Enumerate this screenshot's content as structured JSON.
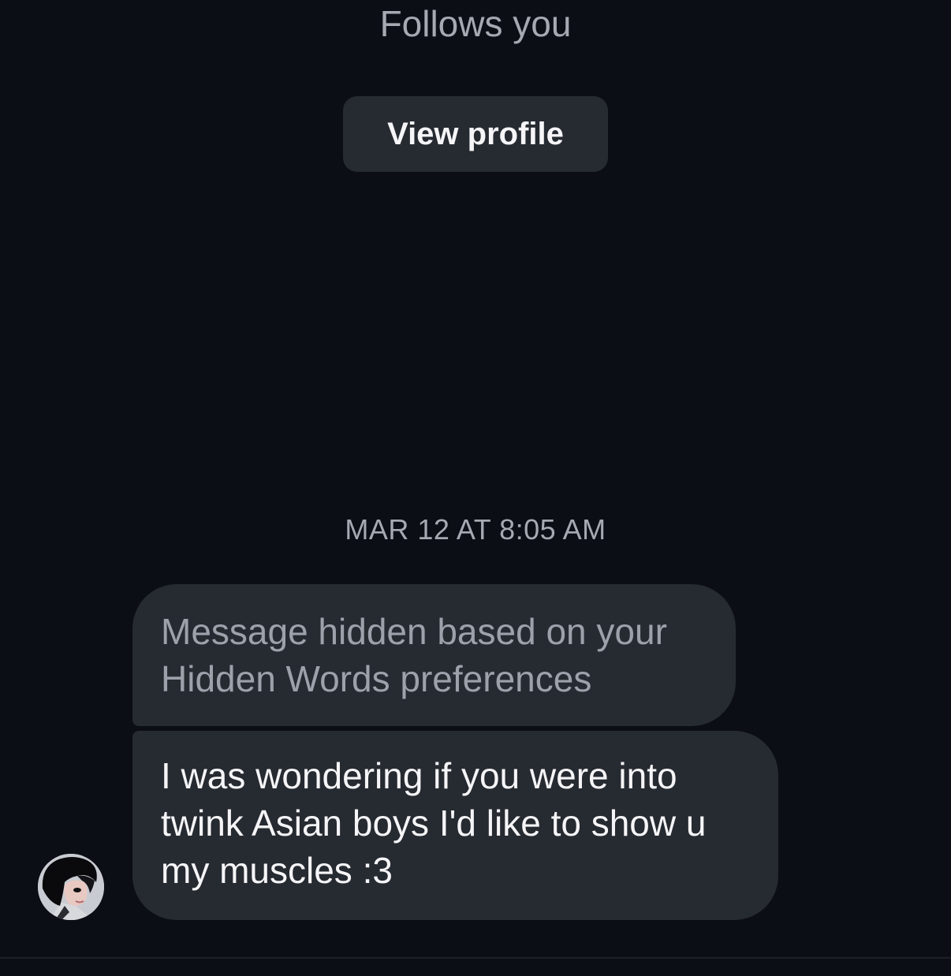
{
  "header": {
    "follows_text": "Follows you",
    "view_profile_label": "View profile"
  },
  "thread": {
    "timestamp": "MAR 12 AT 8:05 AM",
    "messages": [
      {
        "type": "hidden",
        "text": "Message hidden based on your Hidden Words preferences"
      },
      {
        "type": "text",
        "text": "I was wondering if you were into twink Asian boys I'd like to show u my muscles :3"
      }
    ]
  },
  "sender": {
    "avatar_icon": "profile-photo"
  },
  "colors": {
    "background": "#0b0e15",
    "bubble": "#262a31",
    "muted_text": "#a6a9b1",
    "primary_text": "#f5f5f7"
  }
}
